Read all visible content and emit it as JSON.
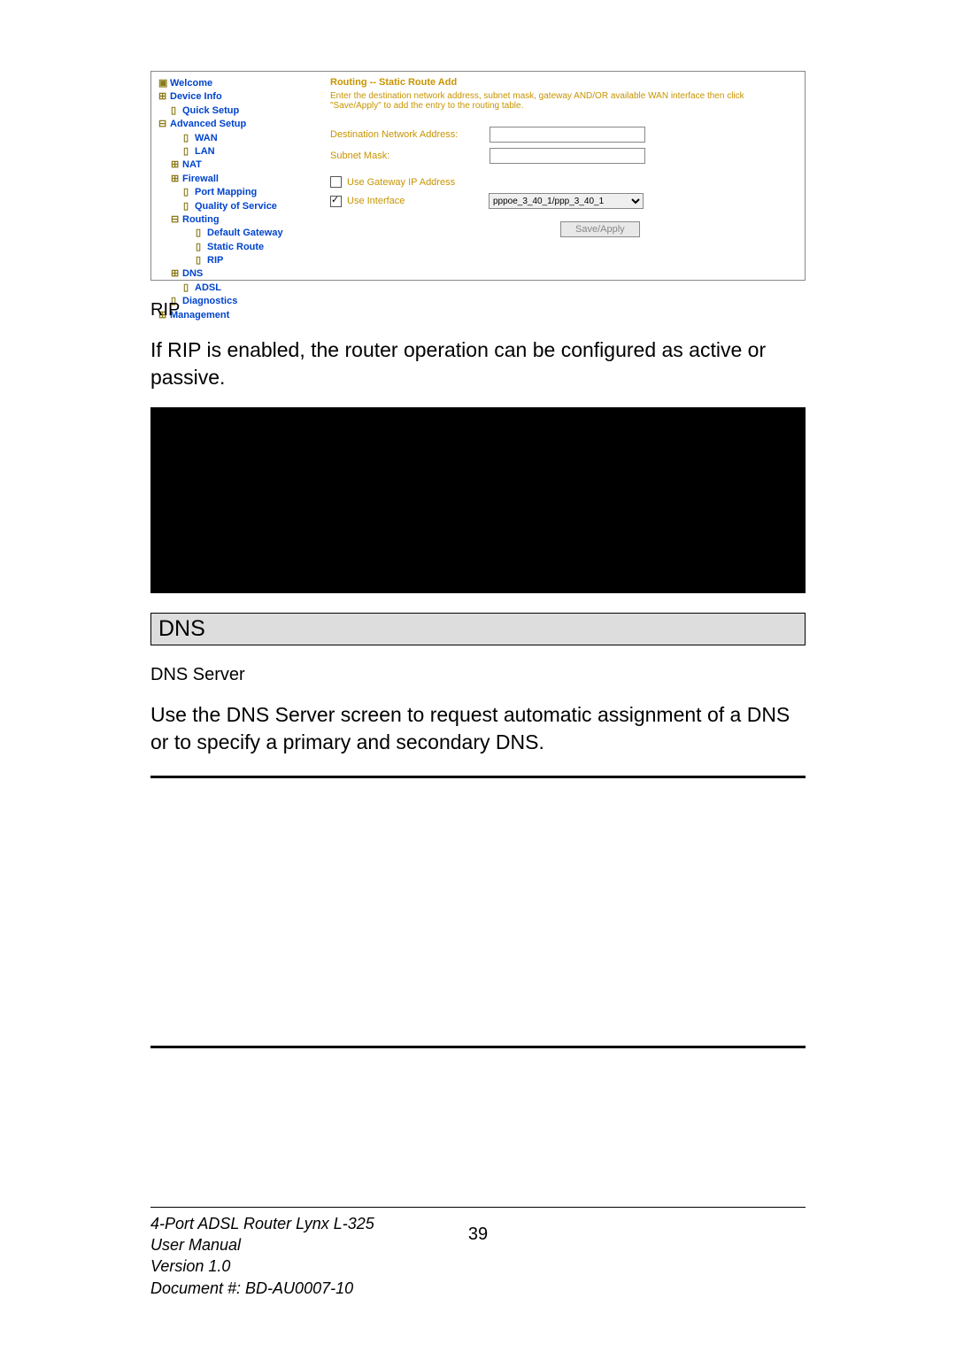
{
  "tree": {
    "welcome": "Welcome",
    "device_info": "Device Info",
    "quick_setup": "Quick Setup",
    "advanced_setup": "Advanced Setup",
    "wan": "WAN",
    "lan": "LAN",
    "nat": "NAT",
    "firewall": "Firewall",
    "port_mapping": "Port Mapping",
    "qos": "Quality of Service",
    "routing": "Routing",
    "default_gateway": "Default Gateway",
    "static_route": "Static Route",
    "rip": "RIP",
    "dns": "DNS",
    "adsl": "ADSL",
    "diagnostics": "Diagnostics",
    "management": "Management"
  },
  "panel1": {
    "title": "Routing -- Static Route Add",
    "desc": "Enter the destination network address, subnet mask, gateway AND/OR available WAN interface then click \"Save/Apply\" to add the entry to the routing table.",
    "dest_label": "Destination Network Address:",
    "subnet_label": "Subnet Mask:",
    "use_gw_label": "Use Gateway IP Address",
    "use_if_label": "Use Interface",
    "if_value": "pppoe_3_40_1/ppp_3_40_1",
    "save_btn": "Save/Apply"
  },
  "body": {
    "rip_heading": "RIP",
    "rip_text": "If RIP is enabled, the router operation can be configured as active or passive.",
    "dns_bar": "DNS",
    "dns_server_heading": "DNS Server",
    "dns_text": "Use the DNS Server screen to request automatic assignment of a DNS or to specify a primary and secondary DNS."
  },
  "footer": {
    "l1": "4-Port ADSL Router Lynx L-325",
    "l2": "User Manual",
    "l3": "Version 1.0",
    "l4": "Document #:  BD-AU0007-10",
    "page_no": "39"
  }
}
